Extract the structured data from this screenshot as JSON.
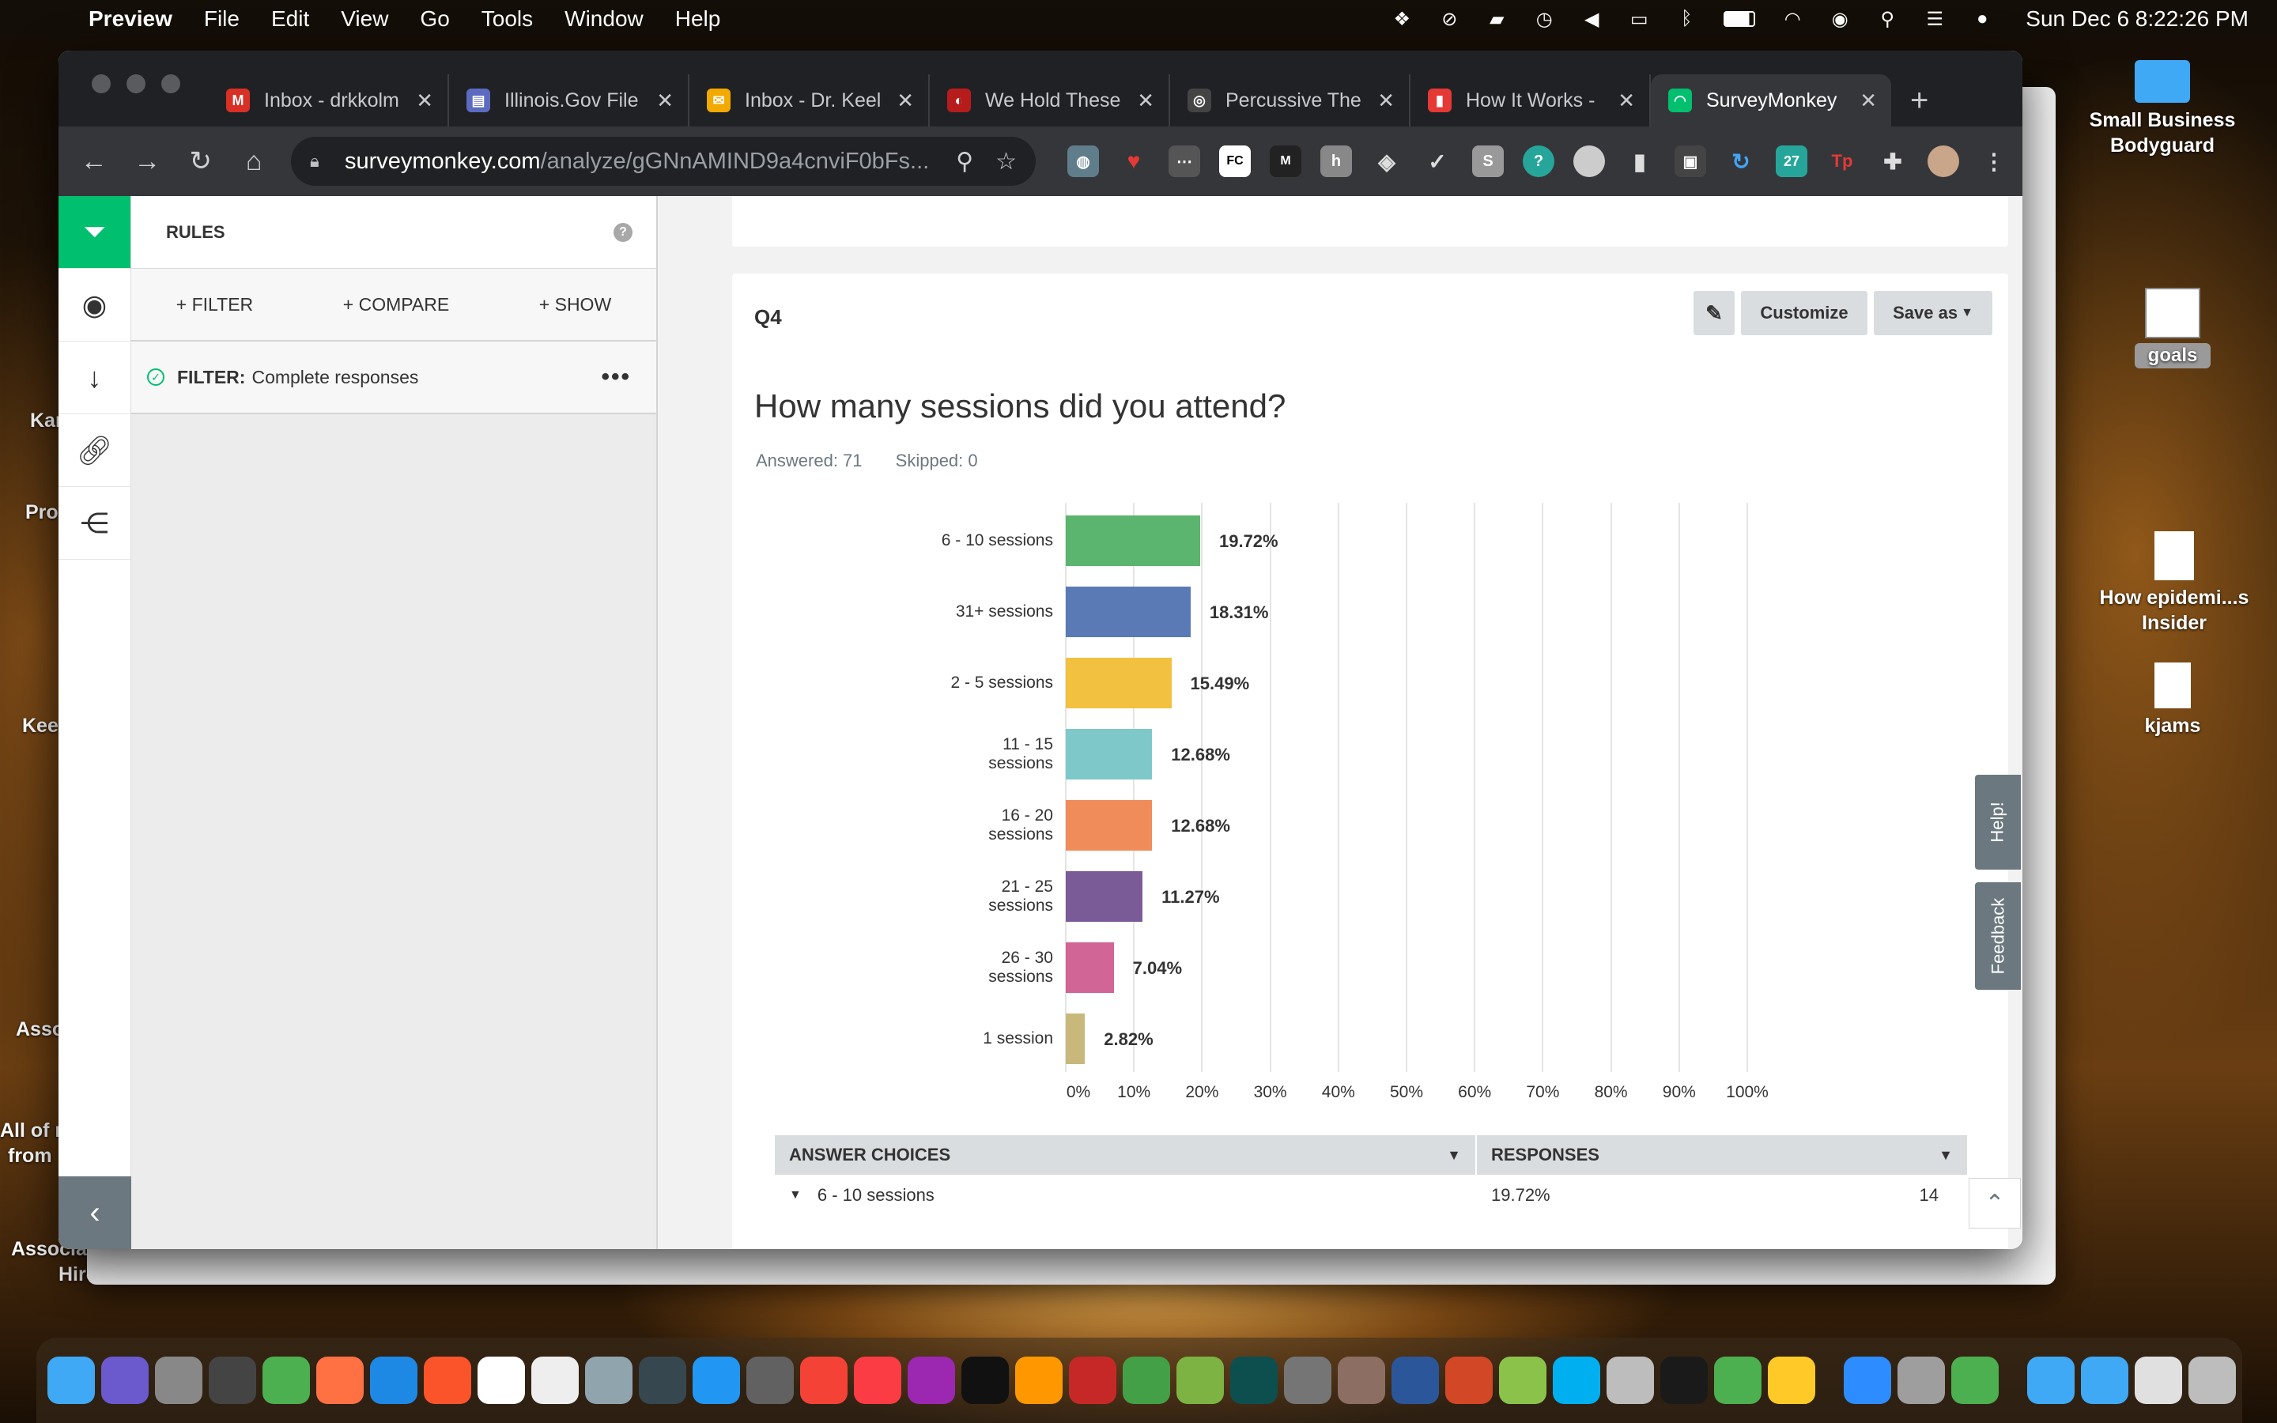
{
  "menubar": {
    "app": "Preview",
    "items": [
      "File",
      "Edit",
      "View",
      "Go",
      "Tools",
      "Window",
      "Help"
    ],
    "clock": "Sun Dec 6  8:22:26 PM"
  },
  "desktop": {
    "items": [
      {
        "label": "Small Business Bodyguard"
      },
      {
        "label": "goals"
      },
      {
        "label": "How epidemi...s Insider"
      },
      {
        "label": "kjams"
      }
    ],
    "left_labels": [
      "Kar",
      "Pro",
      "Kee",
      "Asso",
      "All of r",
      "from",
      "Associa",
      "Hire"
    ]
  },
  "browser": {
    "tabs": [
      {
        "label": "Inbox - drkkolm",
        "color": "#d93025",
        "glyph": "M"
      },
      {
        "label": "Illinois.Gov File",
        "color": "#5c6bc0",
        "glyph": "▤"
      },
      {
        "label": "Inbox - Dr. Keel",
        "color": "#f2a900",
        "glyph": "✉"
      },
      {
        "label": "We Hold These",
        "color": "#b71c1c",
        "glyph": "◐"
      },
      {
        "label": "Percussive The",
        "color": "#444444",
        "glyph": "◎"
      },
      {
        "label": "How It Works -",
        "color": "#e53935",
        "glyph": "▮"
      },
      {
        "label": "SurveyMonkey",
        "color": "#00bf6f",
        "glyph": "◠"
      }
    ],
    "url_host": "surveymonkey.com",
    "url_path": "/analyze/gGNnAMIND9a4cnviF0bFs..."
  },
  "rules": {
    "title": "RULES",
    "actions": [
      "+ FILTER",
      "+ COMPARE",
      "+ SHOW"
    ],
    "filter_label": "FILTER:",
    "filter_value": "Complete responses"
  },
  "question": {
    "id": "Q4",
    "title": "How many sessions did you attend?",
    "answered": "Answered: 71",
    "skipped": "Skipped: 0",
    "buttons": {
      "customize": "Customize",
      "save_as": "Save as"
    }
  },
  "chart_data": {
    "type": "bar",
    "orientation": "horizontal",
    "categories": [
      "6 - 10 sessions",
      "31+ sessions",
      "2 - 5 sessions",
      "11 - 15 sessions",
      "16 - 20 sessions",
      "21 - 25 sessions",
      "26 - 30 sessions",
      "1 session"
    ],
    "values": [
      19.72,
      18.31,
      15.49,
      12.68,
      12.68,
      11.27,
      7.04,
      2.82
    ],
    "value_labels": [
      "19.72%",
      "18.31%",
      "15.49%",
      "12.68%",
      "12.68%",
      "11.27%",
      "7.04%",
      "2.82%"
    ],
    "colors": [
      "#5bb56e",
      "#5a7ab5",
      "#f2c13f",
      "#7ec8ca",
      "#f08c5a",
      "#7a5b97",
      "#d06596",
      "#c8b87c"
    ],
    "xlim": [
      0,
      100
    ],
    "xticks": [
      "0%",
      "10%",
      "20%",
      "30%",
      "40%",
      "50%",
      "60%",
      "70%",
      "80%",
      "90%",
      "100%"
    ],
    "grid": true
  },
  "table": {
    "headers": [
      "ANSWER CHOICES",
      "RESPONSES"
    ],
    "rows": [
      {
        "choice": "6 - 10 sessions",
        "percent": "19.72%",
        "count": "14"
      }
    ]
  },
  "side_tabs": {
    "help": "Help!",
    "feedback": "Feedback"
  },
  "colors": {
    "accent": "#00bf6f",
    "rail_gray": "#6b787f"
  }
}
